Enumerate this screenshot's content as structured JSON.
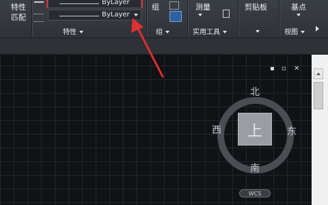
{
  "ribbon": {
    "properties": {
      "match_label_top": "特性",
      "match_label_bottom": "匹配",
      "color_dropdown_value": "ByLayer",
      "linetype_dropdown_value": "ByLayer",
      "group_title": "特性"
    },
    "groups": {
      "group_label": "组",
      "group_title": "组"
    },
    "utilities": {
      "measure_label": "测量",
      "group_title": "实用工具"
    },
    "clipboard": {
      "label": "剪贴板"
    },
    "view": {
      "basepoint_label": "基点",
      "group_title": "视图"
    }
  },
  "viewport": {
    "controls": [
      "▪",
      "▫",
      "✕"
    ]
  },
  "viewcube": {
    "north": "北",
    "south": "南",
    "east": "东",
    "west": "西",
    "face": "上",
    "wcs": "WCS"
  },
  "colors": {
    "annotation_red": "#e03030",
    "canvas_bg": "#101216",
    "ribbon_bg": "#2f3339"
  }
}
